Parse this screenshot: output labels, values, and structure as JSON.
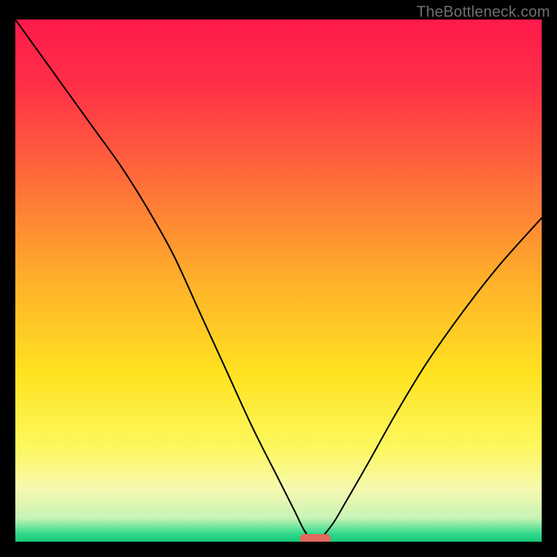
{
  "watermark": "TheBottleneck.com",
  "chart_data": {
    "type": "line",
    "title": "",
    "xlabel": "",
    "ylabel": "",
    "xlim": [
      0,
      100
    ],
    "ylim": [
      0,
      100
    ],
    "grid": false,
    "legend": false,
    "marker_x": 57,
    "gradient_stops": [
      {
        "offset": 0.0,
        "color": "#ff1a4b"
      },
      {
        "offset": 0.13,
        "color": "#ff3047"
      },
      {
        "offset": 0.3,
        "color": "#ff6a3a"
      },
      {
        "offset": 0.5,
        "color": "#ffb02a"
      },
      {
        "offset": 0.68,
        "color": "#ffe321"
      },
      {
        "offset": 0.82,
        "color": "#fdf85f"
      },
      {
        "offset": 0.9,
        "color": "#f6f9b0"
      },
      {
        "offset": 0.955,
        "color": "#c7f3b6"
      },
      {
        "offset": 0.985,
        "color": "#2fd98b"
      },
      {
        "offset": 1.0,
        "color": "#17c877"
      }
    ],
    "series": [
      {
        "name": "bottleneck-curve",
        "x": [
          0,
          5,
          10,
          15,
          20,
          25,
          30,
          35,
          40,
          45,
          50,
          53,
          55,
          57,
          60,
          63,
          67,
          72,
          78,
          85,
          92,
          100
        ],
        "y": [
          100,
          93,
          86,
          79,
          72,
          64,
          55,
          44,
          33,
          22,
          12,
          6,
          2,
          0,
          3,
          8,
          15,
          24,
          34,
          44,
          53,
          62
        ]
      }
    ]
  }
}
